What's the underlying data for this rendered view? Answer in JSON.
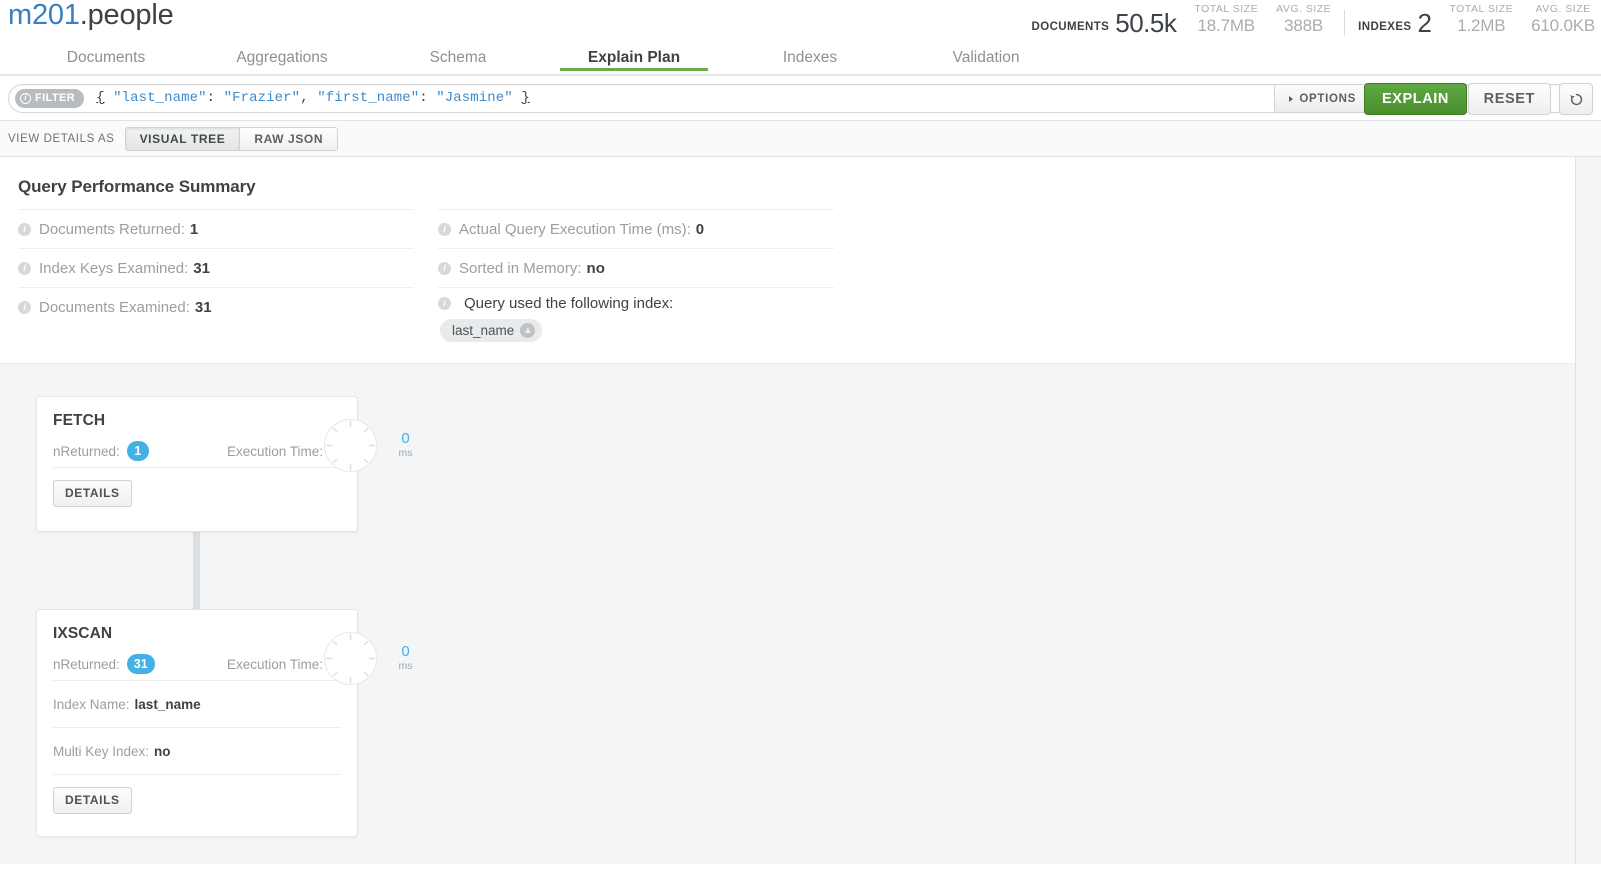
{
  "header": {
    "db": "m201",
    "separator": ".",
    "collection": "people",
    "stats": {
      "documents": {
        "label": "DOCUMENTS",
        "count": "50.5k",
        "total_size_label": "TOTAL SIZE",
        "total_size": "18.7MB",
        "avg_size_label": "AVG. SIZE",
        "avg_size": "388B"
      },
      "indexes": {
        "label": "INDEXES",
        "count": "2",
        "total_size_label": "TOTAL SIZE",
        "total_size": "1.2MB",
        "avg_size_label": "AVG. SIZE",
        "avg_size": "610.0KB"
      }
    }
  },
  "tabs": [
    {
      "label": "Documents",
      "active": false
    },
    {
      "label": "Aggregations",
      "active": false
    },
    {
      "label": "Schema",
      "active": false
    },
    {
      "label": "Explain Plan",
      "active": true
    },
    {
      "label": "Indexes",
      "active": false
    },
    {
      "label": "Validation",
      "active": false
    }
  ],
  "querybar": {
    "filter_badge": "FILTER",
    "filter_info_icon": "info-icon",
    "query": {
      "open_brace": "{",
      "key1": "\"last_name\"",
      "colon1": ":",
      "value1": "\"Frazier\"",
      "comma": ",",
      "key2": "\"first_name\"",
      "colon2": ":",
      "value2": "\"Jasmine\"",
      "close_brace": "}"
    },
    "options_label": "OPTIONS",
    "explain_label": "EXPLAIN",
    "reset_label": "RESET",
    "history_icon": "history-icon",
    "explain_color": "#4f9e32"
  },
  "viewbar": {
    "label": "VIEW DETAILS AS",
    "segments": [
      {
        "label": "VISUAL TREE",
        "active": true
      },
      {
        "label": "RAW JSON",
        "active": false
      }
    ]
  },
  "summary": {
    "title": "Query Performance Summary",
    "left_rows": [
      {
        "label": "Documents Returned:",
        "value": "1"
      },
      {
        "label": "Index Keys Examined:",
        "value": "31"
      },
      {
        "label": "Documents Examined:",
        "value": "31"
      }
    ],
    "right_rows": [
      {
        "label": "Actual Query Execution Time (ms):",
        "value": "0"
      },
      {
        "label": "Sorted in Memory:",
        "value": "no"
      }
    ],
    "index_used": {
      "label": "Query used the following index:",
      "badges": [
        {
          "name": "last_name",
          "direction_icon": "arrow-up-icon",
          "direction": "ascending"
        }
      ]
    }
  },
  "tree": {
    "stages": [
      {
        "name": "FETCH",
        "nreturned_label": "nReturned:",
        "nreturned": "1",
        "exec_time_label": "Execution Time:",
        "exec_time": "0",
        "exec_time_unit": "ms",
        "rows": [],
        "details_label": "DETAILS"
      },
      {
        "name": "IXSCAN",
        "nreturned_label": "nReturned:",
        "nreturned": "31",
        "exec_time_label": "Execution Time:",
        "exec_time": "0",
        "exec_time_unit": "ms",
        "rows": [
          {
            "label": "Index Name:",
            "value": "last_name"
          },
          {
            "label": "Multi Key Index:",
            "value": "no"
          }
        ],
        "details_label": "DETAILS"
      }
    ]
  },
  "colors": {
    "accent_green": "#6bab4c",
    "accent_blue": "#43b1e5",
    "db_link": "#3a7fc1",
    "code_string": "#3b8bd0",
    "page_bg": "#f3f5f6"
  }
}
